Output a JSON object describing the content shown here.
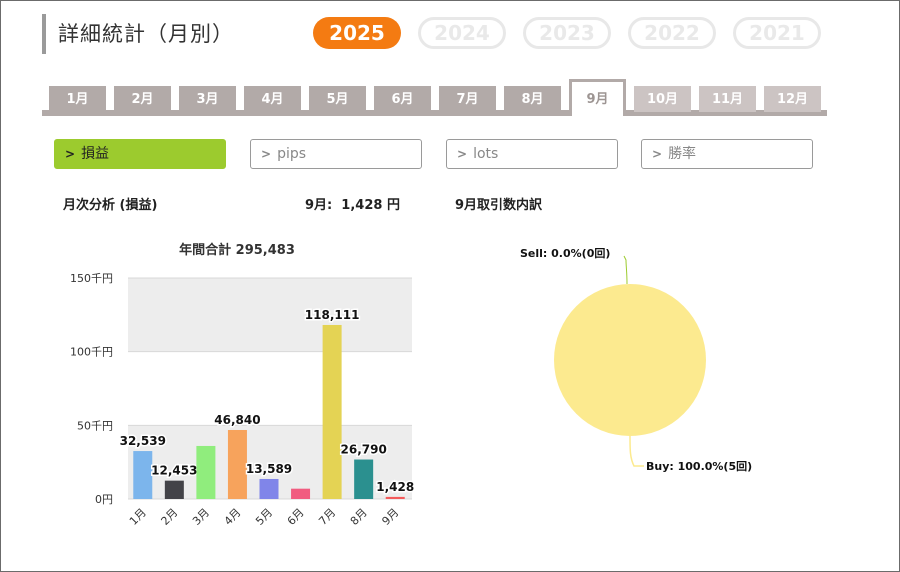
{
  "header": {
    "title": "詳細統計（月別）"
  },
  "years": [
    {
      "label": "2025",
      "active": true
    },
    {
      "label": "2024",
      "active": false
    },
    {
      "label": "2023",
      "active": false
    },
    {
      "label": "2022",
      "active": false
    },
    {
      "label": "2021",
      "active": false
    }
  ],
  "months": [
    {
      "label": "1月",
      "state": "normal"
    },
    {
      "label": "2月",
      "state": "normal"
    },
    {
      "label": "3月",
      "state": "normal"
    },
    {
      "label": "4月",
      "state": "normal"
    },
    {
      "label": "5月",
      "state": "normal"
    },
    {
      "label": "6月",
      "state": "normal"
    },
    {
      "label": "7月",
      "state": "normal"
    },
    {
      "label": "8月",
      "state": "normal"
    },
    {
      "label": "9月",
      "state": "active"
    },
    {
      "label": "10月",
      "state": "disabled"
    },
    {
      "label": "11月",
      "state": "disabled"
    },
    {
      "label": "12月",
      "state": "disabled"
    }
  ],
  "metrics": [
    {
      "label": "損益",
      "active": true
    },
    {
      "label": "pips",
      "active": false
    },
    {
      "label": "lots",
      "active": false
    },
    {
      "label": "勝率",
      "active": false
    }
  ],
  "chevron_glyph": ">",
  "analysis": {
    "monthly_title": "月次分析 (損益)",
    "current_month_value": "9月:  1,428 円",
    "breakdown_title": "9月取引数内訳"
  },
  "chart_data": [
    {
      "type": "bar",
      "title": "年間合計 295,483",
      "categories": [
        "1月",
        "2月",
        "3月",
        "4月",
        "5月",
        "6月",
        "7月",
        "8月",
        "9月"
      ],
      "values": [
        32539,
        12453,
        36000,
        46840,
        13589,
        7000,
        118111,
        26790,
        1428
      ],
      "data_labels": [
        "32,539",
        "12,453",
        "",
        "46,840",
        "13,589",
        "",
        "118,111",
        "26,790",
        "1,428"
      ],
      "colors": [
        "#7cb5ec",
        "#434348",
        "#90ed7d",
        "#f7a35c",
        "#8085e9",
        "#f15c80",
        "#e4d354",
        "#2b908f",
        "#f45b5b"
      ],
      "ylim": [
        0,
        150000
      ],
      "y_ticks": [
        {
          "value": 0,
          "label": "0円"
        },
        {
          "value": 50000,
          "label": "50千円"
        },
        {
          "value": 100000,
          "label": "100千円"
        },
        {
          "value": 150000,
          "label": "150千円"
        }
      ],
      "plot_bands": [
        {
          "from": 0,
          "to": 50000,
          "color": "#ededed"
        },
        {
          "from": 100000,
          "to": 150000,
          "color": "#ededed"
        }
      ],
      "grid": true
    },
    {
      "type": "pie",
      "slices": [
        {
          "name": "Sell",
          "percent": 0.0,
          "count": 0,
          "label": "Sell: 0.0%(0回)",
          "color": "#9ccb2e"
        },
        {
          "name": "Buy",
          "percent": 100.0,
          "count": 5,
          "label": "Buy: 100.0%(5回)",
          "color": "#fcea8f"
        }
      ]
    }
  ]
}
